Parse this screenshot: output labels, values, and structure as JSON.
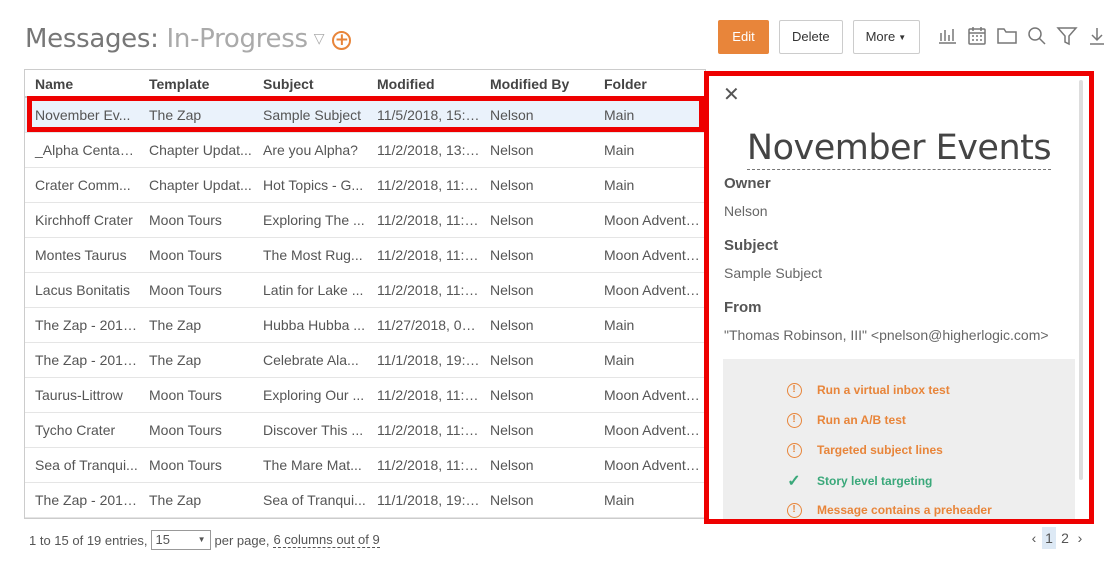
{
  "header": {
    "title": "Messages:",
    "view": "In-Progress"
  },
  "toolbar": {
    "edit_label": "Edit",
    "delete_label": "Delete",
    "more_label": "More",
    "icons": [
      "bar-chart-icon",
      "calendar-icon",
      "folder-icon",
      "search-icon",
      "filter-icon",
      "download-icon"
    ]
  },
  "table": {
    "columns": [
      "Name",
      "Template",
      "Subject",
      "Modified",
      "Modified By",
      "Folder"
    ],
    "rows": [
      [
        "November Ev...",
        "The Zap",
        "Sample Subject",
        "11/5/2018, 15:5...",
        "Nelson",
        "Main"
      ],
      [
        "_Alpha Centau...",
        "Chapter Updat...",
        "Are you Alpha?",
        "11/2/2018, 13:2...",
        "Nelson",
        "Main"
      ],
      [
        "Crater Comm...",
        "Chapter Updat...",
        "Hot Topics - G...",
        "11/2/2018, 11:2...",
        "Nelson",
        "Main"
      ],
      [
        "Kirchhoff Crater",
        "Moon Tours",
        "Exploring The ...",
        "11/2/2018, 11:2...",
        "Nelson",
        "Moon Adventu..."
      ],
      [
        "Montes Taurus",
        "Moon Tours",
        "The Most Rug...",
        "11/2/2018, 11:31...",
        "Nelson",
        "Moon Adventu..."
      ],
      [
        "Lacus Bonitatis",
        "Moon Tours",
        "Latin for Lake ...",
        "11/2/2018, 11:3...",
        "Nelson",
        "Moon Adventu..."
      ],
      [
        "The Zap - 2018...",
        "The Zap",
        "Hubba Hubba ...",
        "11/27/2018, 09:...",
        "Nelson",
        "Main"
      ],
      [
        "The Zap - 2018...",
        "The Zap",
        "Celebrate Ala...",
        "11/1/2018, 19:18...",
        "Nelson",
        "Main"
      ],
      [
        "Taurus-Littrow",
        "Moon Tours",
        "Exploring Our ...",
        "11/2/2018, 11:3...",
        "Nelson",
        "Moon Adventu..."
      ],
      [
        "Tycho Crater",
        "Moon Tours",
        "Discover This ...",
        "11/2/2018, 11:3...",
        "Nelson",
        "Moon Adventu..."
      ],
      [
        "Sea of Tranqui...",
        "Moon Tours",
        "The Mare Mat...",
        "11/2/2018, 11:0...",
        "Nelson",
        "Moon Adventu..."
      ],
      [
        "The Zap - 2018...",
        "The Zap",
        "Sea of Tranqui...",
        "11/1/2018, 19:15...",
        "Nelson",
        "Main"
      ]
    ]
  },
  "footer": {
    "entries": "1 to 15 of 19 entries,",
    "per_page_value": "15",
    "per_page_label": "per page,",
    "columns_out": "6 columns out of 9",
    "pages": [
      "1",
      "2"
    ],
    "current_page": "1"
  },
  "detail": {
    "title": "November Events",
    "owner_label": "Owner",
    "owner": "Nelson",
    "subject_label": "Subject",
    "subject": "Sample Subject",
    "from_label": "From",
    "from": "\"Thomas Robinson, III\" <pnelson@higherlogic.com>",
    "tips": [
      {
        "text": "Run a virtual inbox test",
        "status": "warn"
      },
      {
        "text": "Run an A/B test",
        "status": "warn"
      },
      {
        "text": "Targeted subject lines",
        "status": "warn"
      },
      {
        "text": "Story level targeting",
        "status": "ok"
      },
      {
        "text": "Message contains a preheader",
        "status": "warn"
      }
    ]
  },
  "colors": {
    "accent": "#e8853a",
    "success": "#3aa87a",
    "highlight": "#ee0000",
    "selected_row": "#eaf2fb"
  }
}
